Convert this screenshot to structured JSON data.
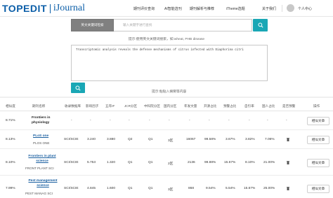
{
  "header": {
    "logo_left": "TOPEDIT",
    "logo_right": "iJournal",
    "nav": [
      "期刊评价查询",
      "AI智能选刊",
      "期刊解析与推荐",
      "iTheme选题",
      "关于我们"
    ],
    "user_label": "个人中心"
  },
  "search": {
    "type_label": "英文关键词检索",
    "placeholder": "输入关键字进行查找",
    "hint": "提示:使用英文关键词搜索，如:wheat, PHB disease",
    "abstract_text": "Transcriptomic analysis reveals the defense mechanisms of citrus infected with Diaphorina citri",
    "hint2": "提示:粘贴入摘要等内容"
  },
  "table": {
    "headers": [
      "相似度",
      "期刊名称",
      "收录数据库",
      "影响因子",
      "五年IF",
      "JCR分区",
      "中科院分区",
      "国内分区",
      "年发文量",
      "开源占比",
      "预警占比",
      "自引率",
      "国人占比",
      "是否预警",
      "操作"
    ],
    "rows": [
      {
        "similarity": "8.71%",
        "name": "Frontiers in physiology",
        "abbr": "",
        "link": false,
        "db": "-",
        "if": "-",
        "if5": "-",
        "jcr": "-",
        "cas": "-",
        "domestic": "-",
        "annual": "-",
        "oa": "-",
        "warn_ratio": "-",
        "self_cite": "-",
        "cn_ratio": "-",
        "warn": "-",
        "action": "相似文章"
      },
      {
        "similarity": "8.13%",
        "name": "PLoS one",
        "abbr": "PLOS ONE",
        "link": true,
        "db": "SCI/SCIE",
        "if": "3.240",
        "if5": "3.880",
        "jcr": "Q2",
        "cas": "Q1",
        "domestic": "3区",
        "annual": "16067",
        "oa": "99.58%",
        "warn_ratio": "3.67%",
        "self_cite": "3.82%",
        "cn_ratio": "7.06%",
        "warn": "",
        "action": "相似文章"
      },
      {
        "similarity": "8.10%",
        "name": "Frontiers in plant science",
        "abbr": "FRONT PLANT SCI",
        "link": true,
        "db": "SCI/SCIE",
        "if": "5.753",
        "if5": "1.320",
        "jcr": "Q1",
        "cas": "Q1",
        "domestic": "2区",
        "annual": "2136",
        "oa": "99.88%",
        "warn_ratio": "15.67%",
        "self_cite": "8.10%",
        "cn_ratio": "21.00%",
        "warn": "",
        "action": "相似文章"
      },
      {
        "similarity": "7.99%",
        "name": "Pest management science",
        "abbr": "PEST MANAG SCI",
        "link": true,
        "db": "SCI/SCIE",
        "if": "4.845",
        "if5": "1.600",
        "jcr": "Q1",
        "cas": "Q1",
        "domestic": "3区",
        "annual": "868",
        "oa": "9.54%",
        "warn_ratio": "5.54%",
        "self_cite": "15.67%",
        "cn_ratio": "25.00%",
        "warn": "",
        "action": "相似文章"
      }
    ]
  },
  "colors": {
    "accent": "#1aa7b5",
    "brand": "#0b5ea8",
    "link": "#1a5fa0"
  }
}
